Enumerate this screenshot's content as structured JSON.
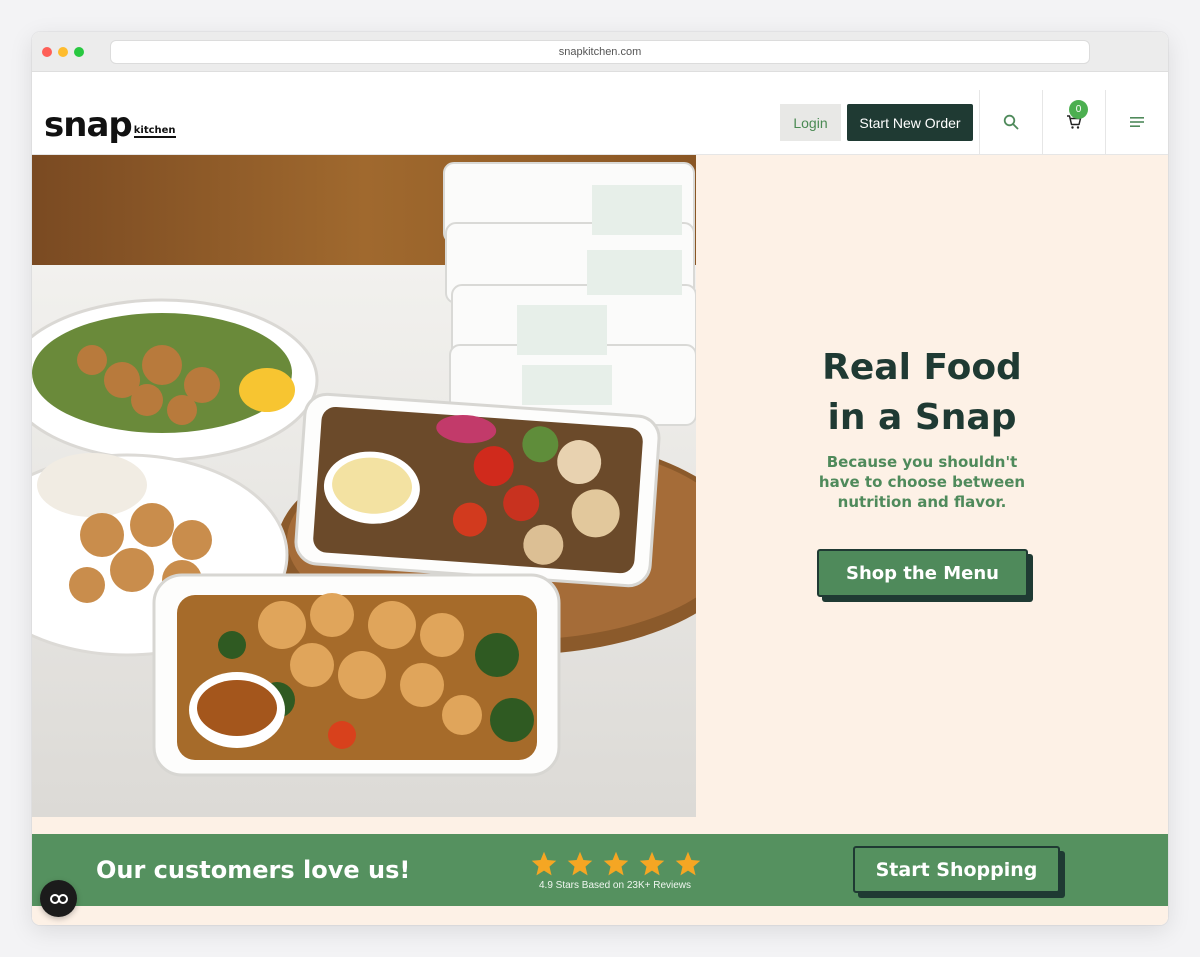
{
  "browser": {
    "url": "snapkitchen.com"
  },
  "header": {
    "logo_main": "snap",
    "logo_sub": "kitchen",
    "login_label": "Login",
    "start_order_label": "Start New Order",
    "search_icon": "search-icon",
    "cart_icon": "cart-icon",
    "cart_count": "0",
    "menu_icon": "hamburger-menu-icon"
  },
  "hero": {
    "title_line1": "Real Food",
    "title_line2": "in a Snap",
    "subtitle_line1": "Because you shouldn't",
    "subtitle_line2": "have to choose between",
    "subtitle_line3": "nutrition and flavor.",
    "cta_label": "Shop the Menu"
  },
  "reviews_banner": {
    "text": "Our customers love us!",
    "rating_stars": 5,
    "rating_caption": "4.9 Stars Based on 23K+ Reviews",
    "cta_label": "Start Shopping"
  },
  "chat": {
    "icon": "chat-widget-icon"
  },
  "colors": {
    "brand_dark": "#1f3a33",
    "brand_green": "#4f8a5b",
    "banner_green": "#55915f",
    "cream": "#fdf1e6",
    "star": "#f5a623",
    "badge": "#4caf50"
  }
}
